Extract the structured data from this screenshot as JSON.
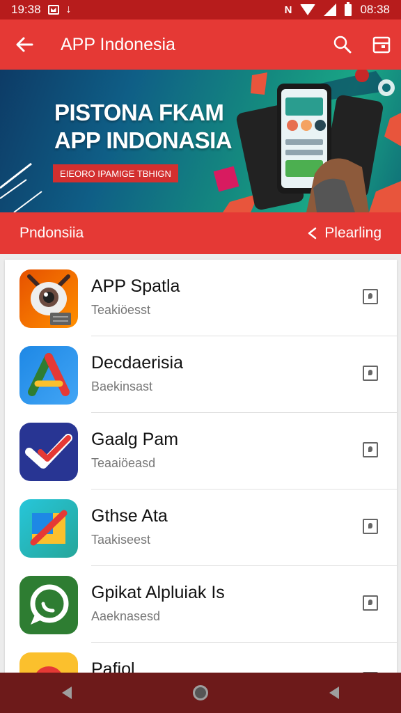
{
  "status_bar": {
    "time_left": "19:38",
    "time_right": "08:38",
    "nfc_label": "N"
  },
  "app_bar": {
    "title": "APP Indonesia",
    "back_icon": "arrow-left-icon",
    "search_icon": "search-icon",
    "menu_icon": "calendar-icon"
  },
  "banner": {
    "title_line1": "PISTONA FKAM",
    "title_line2": "APP INDONASIA",
    "tag": "EIEORO IPAMIGE TBHIGN"
  },
  "subheader": {
    "label": "Pndonsiia",
    "action_label": "Plearling"
  },
  "apps": [
    {
      "name": "APP Spatla",
      "sub": "Teakiöesst"
    },
    {
      "name": "Decdaerisia",
      "sub": "Baekinsast"
    },
    {
      "name": "Gaalg Pam",
      "sub": "Teaaiöeasd"
    },
    {
      "name": "Gthse Ata",
      "sub": "Taakiseest"
    },
    {
      "name": "Gpikat Alpluiak Is",
      "sub": "Aaeknasesd"
    },
    {
      "name": "Pafiol",
      "sub": ""
    }
  ],
  "colors": {
    "primary": "#e53935",
    "status": "#b71c1c",
    "nav": "#6d1a1a"
  }
}
